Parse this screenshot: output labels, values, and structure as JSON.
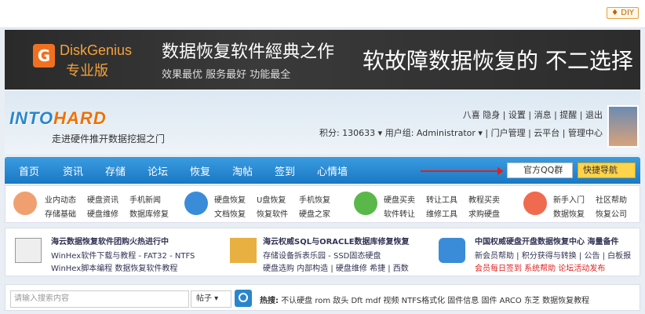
{
  "diy": "♦ DIY",
  "banner": {
    "brand": "DiskGenius",
    "brand_sub": "专业版",
    "tagline1": "数据恢复软件經典之作",
    "tagline2": "效果最优 服务最好 功能最全",
    "tagline3": "软故障数据恢复的 不二选择"
  },
  "header": {
    "brand_a": "INTO",
    "brand_b": "HARD",
    "slogan": "走进硬件推开数据挖掘之门",
    "userbar": "八喜 隐身 | 设置 | 消息 | 提醒 | 退出",
    "userbar2": "积分: 130633 ▾    用户组: Administrator ▾  | 门户管理 | 云平台 | 管理中心"
  },
  "nav": {
    "items": [
      "首页",
      "资讯",
      "存储",
      "论坛",
      "恢复",
      "淘帖",
      "签到",
      "心情墙"
    ],
    "qq": "官方QQ群",
    "quick": "快捷导航"
  },
  "cats": [
    [
      "业内动态",
      "硬盘资讯",
      "手机新闻",
      "存储基础",
      "硬盘维修",
      "数据库修复"
    ],
    [
      "硬盘恢复",
      "U盘恢复",
      "手机恢复",
      "文档恢复",
      "恢复软件",
      "硬盘之家"
    ],
    [
      "硬盘买卖",
      "转让工具",
      "教程买卖",
      "软件转让",
      "维修工具",
      "求购硬盘"
    ],
    [
      "新手入门",
      "社区帮助",
      "数据恢复",
      "恢复公司"
    ]
  ],
  "feat": {
    "a1": "海云数据恢复软件团购火热进行中",
    "a2": "WinHex软件下载与教程 - FAT32 - NTFS",
    "a3": "WinHex脚本编程 数据恢复软件教程",
    "b1": "海云权威SQL与ORACLE数据库修复恢复",
    "b2": "存储设备拆表乐园 - SSD固态硬盘",
    "b3": "硬盘选购 内部构造 | 硬盘维修 希捷 | 西数",
    "c1": "中国权威硬盘开盘数据恢复中心 海量备件",
    "c2": "新会员帮助 | 积分获得与转换 | 公告 | 白板报",
    "c3": "会员每日签到 系统帮助 论坛活动发布"
  },
  "search": {
    "placeholder": "请输入搜索内容",
    "type": "帖子 ▾",
    "hot_label": "热搜:",
    "hot": "不认硬盘 rom 敌头 Dft mdf 视频 NTFS格式化 固件信息 固件 ARCO 东芝 数据恢复教程"
  }
}
